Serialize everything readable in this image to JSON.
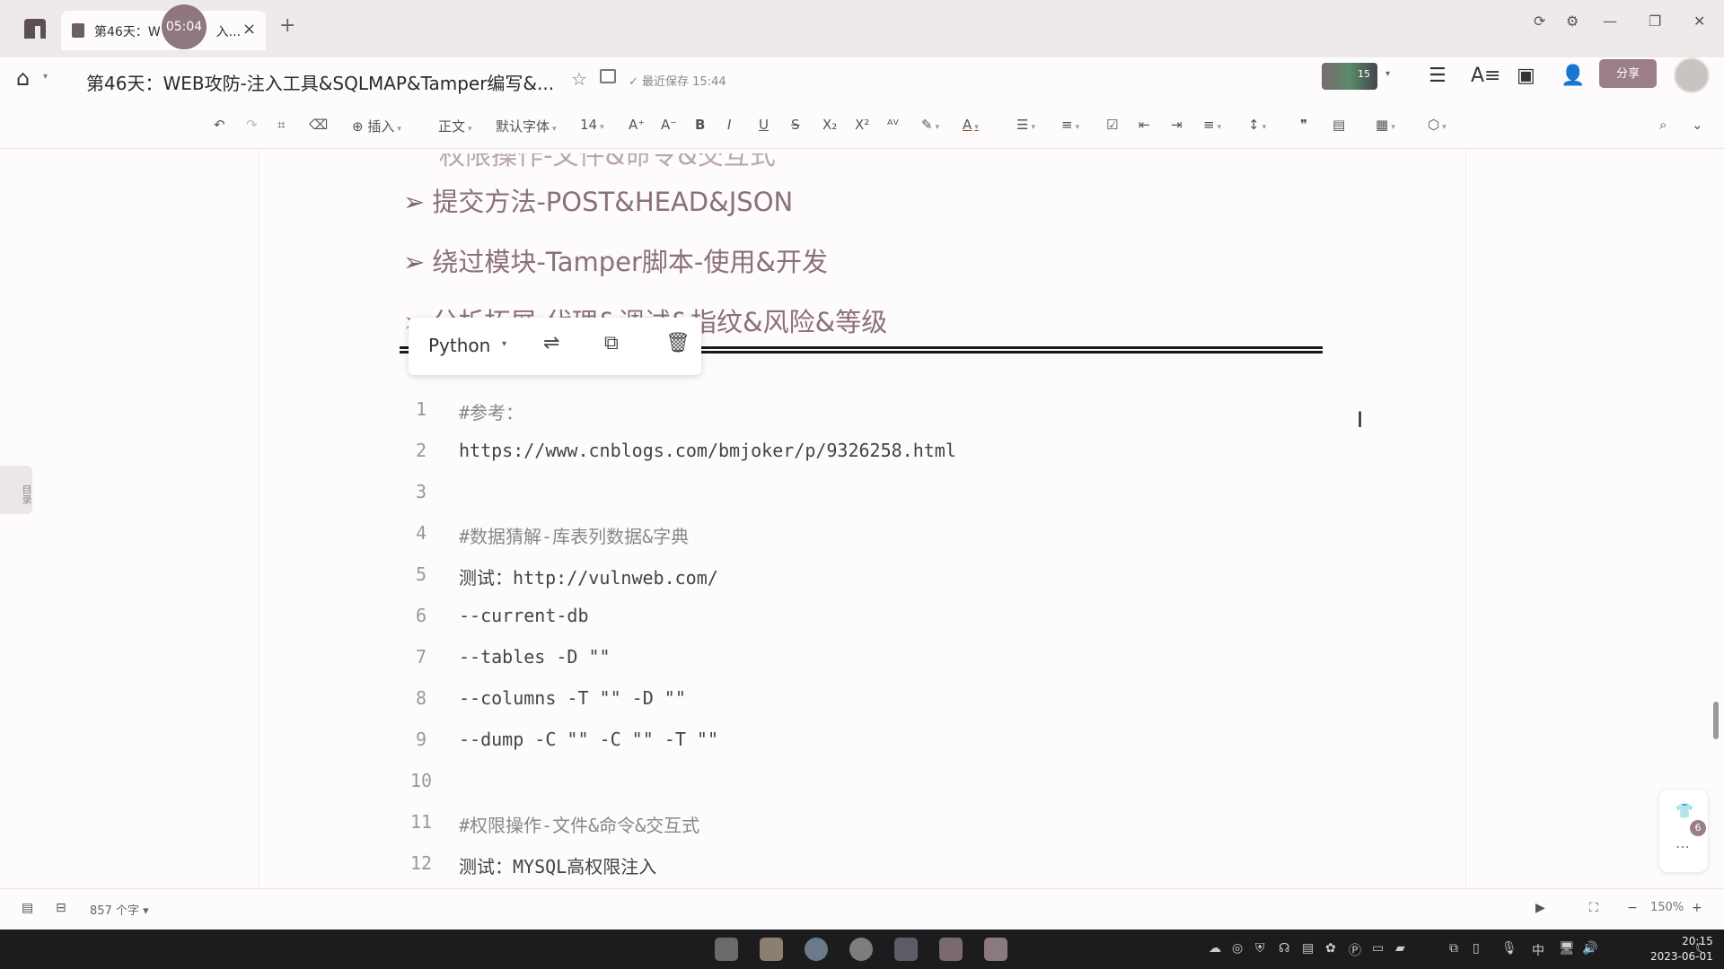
{
  "window": {
    "tab_label": "第46天：W",
    "tab_suffix": "入...",
    "timer": "05:04",
    "new_tab": "+",
    "close_tab": "×"
  },
  "header": {
    "doc_title": "第46天：WEB攻防-注入工具&SQLMAP&Tamper编写&...",
    "saved_status": "最近保存 15:44",
    "share_button": "分享",
    "avatar_count": "15"
  },
  "toolbar": {
    "insert": "插入",
    "paragraph_style": "正文",
    "font": "默认字体",
    "font_size": "14"
  },
  "document": {
    "headings": [
      "提交方法-POST&HEAD&JSON",
      "绕过模块-Tamper脚本-使用&开发",
      "分析拓展-代理&调试&指纹&风险&等级"
    ],
    "partial_heading": "权限操作-文件&命令&交互式",
    "outline_button": "目录",
    "code_block": {
      "language": "Python",
      "lines": [
        {
          "n": "1",
          "text": "#参考：",
          "comment": true
        },
        {
          "n": "2",
          "text": "https://www.cnblogs.com/bmjoker/p/9326258.html",
          "comment": false
        },
        {
          "n": "3",
          "text": "",
          "comment": false
        },
        {
          "n": "4",
          "text": "#数据猜解-库表列数据&字典",
          "comment": true
        },
        {
          "n": "5",
          "text": "测试：http://vulnweb.com/",
          "comment": false
        },
        {
          "n": "6",
          "text": "--current-db",
          "comment": false
        },
        {
          "n": "7",
          "text": "--tables -D \"\"",
          "comment": false
        },
        {
          "n": "8",
          "text": "--columns -T \"\" -D \"\"",
          "comment": false
        },
        {
          "n": "9",
          "text": "--dump -C \"\" -C \"\" -T \"\"",
          "comment": false
        },
        {
          "n": "10",
          "text": "",
          "comment": false
        },
        {
          "n": "11",
          "text": "#权限操作-文件&命令&交互式",
          "comment": true
        },
        {
          "n": "12",
          "text": "测试：MYSQL高权限注入",
          "comment": false
        }
      ]
    },
    "float_badge": "6"
  },
  "statusbar": {
    "word_count": "857 个字",
    "zoom": "150%",
    "zoom_minus": "−",
    "zoom_plus": "+"
  },
  "taskbar": {
    "time": "20:15",
    "date": "2023-06-01",
    "ime": "中"
  },
  "colors": {
    "accent": "#9c7d8a",
    "heading": "#8a6f7c",
    "taskbar": "#1c1c1e"
  }
}
